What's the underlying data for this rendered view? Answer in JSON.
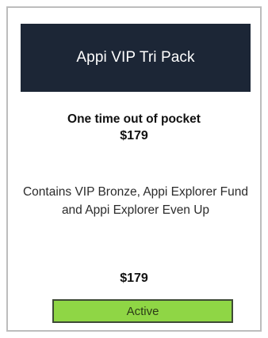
{
  "card": {
    "title": "Appi VIP Tri Pack",
    "out_of_pocket_label": "One time out of pocket",
    "out_of_pocket_price": "$179",
    "description": "Contains VIP Bronze, Appi Explorer Fund and Appi Explorer Even Up",
    "price": "$179",
    "status_label": "Active"
  },
  "colors": {
    "header_background": "#1c2636",
    "status_background": "#8fd645"
  }
}
